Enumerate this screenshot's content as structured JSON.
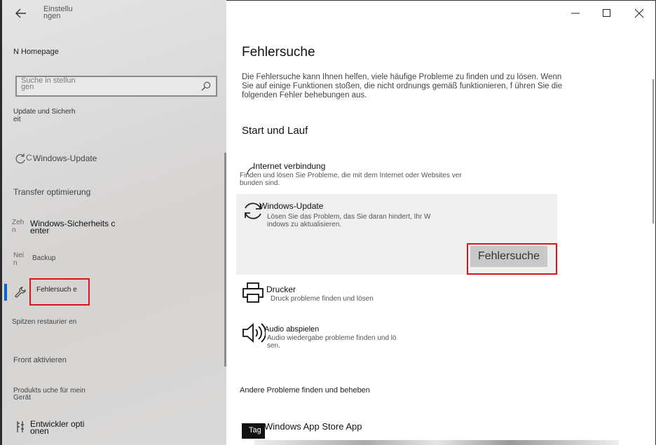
{
  "sidebar": {
    "title": "Einstellu ngen",
    "home": "N Homepage",
    "search_placeholder": "Suche in stellun gen",
    "section": "Update und Sicherh eit",
    "items": [
      {
        "icon": "C",
        "label": "Windows-Update"
      },
      {
        "icon": "",
        "label": "Transfer optimierung"
      },
      {
        "icon": "Zeh n",
        "label": "Windows-Sicherheits c enter"
      },
      {
        "icon": "Nei n",
        "label": "Backup"
      },
      {
        "icon": "",
        "label": "Fehlersuch e"
      },
      {
        "icon": "",
        "label": "Spitzen restaurier en"
      },
      {
        "icon": "",
        "label": "Front aktivieren"
      },
      {
        "icon": "",
        "label": "Produkts uche für mein Gerät"
      },
      {
        "icon": "",
        "label": "Entwickler opti onen"
      }
    ]
  },
  "main": {
    "title": "Fehlersuche",
    "intro": "Die Fehlersuche kann Ihnen helfen, viele häufige Probleme zu finden und zu lösen. Wenn Sie auf einige Funktionen stoßen, die nicht ordnungs gemäß funktionieren, f ühren Sie die folgenden Fehler behebungen aus.",
    "section": "Start und Lauf",
    "internet": {
      "title": "Internet verbindung",
      "desc": "Finden und lösen Sie Probleme, die mit dem Internet oder Websites ver bunden sind."
    },
    "update": {
      "title": "Windows-Update",
      "desc": "Lösen Sie das Problem, das Sie daran hindert, Ihr W indows zu aktualisieren.",
      "button": "Fehlersuche"
    },
    "printer": {
      "title": "Drucker",
      "desc": "Druck probleme finden und lösen"
    },
    "audio": {
      "title": "Audio abspielen",
      "desc": "Audio wiedergabe probleme finden und lö sen."
    },
    "other": "Andere Probleme finden und beheben",
    "store": {
      "title": "Windows App Store App",
      "icon_label": "Tag"
    }
  },
  "colors": {
    "accent": "#0a64c8",
    "highlight": "#d8141e"
  }
}
